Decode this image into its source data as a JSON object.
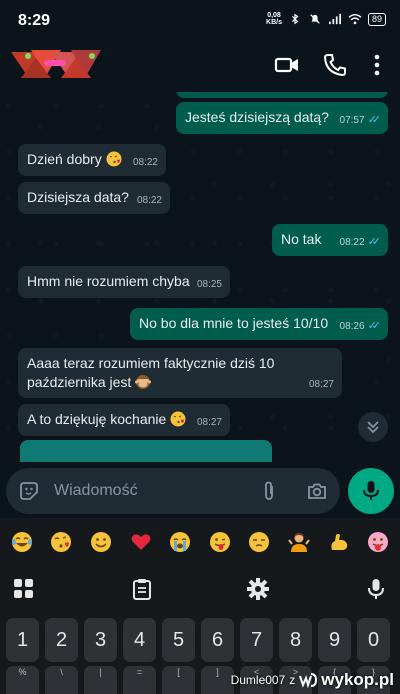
{
  "status_bar": {
    "time": "8:29",
    "speed_value": "0,08",
    "speed_unit": "KB/s",
    "battery": "89"
  },
  "header": {
    "icons": [
      "video-call-icon",
      "voice-call-icon",
      "more-vert-icon"
    ]
  },
  "messages": [
    {
      "dir": "out",
      "text": "Jesteś dzisiejszą datą?",
      "time": "07:57",
      "read": true
    },
    {
      "dir": "in",
      "text": "Dzień dobry",
      "emoji": "kissing-heart",
      "time": "08:22"
    },
    {
      "dir": "in",
      "text": "Dzisiejsza data?",
      "time": "08:22"
    },
    {
      "dir": "out",
      "text": "No tak",
      "time": "08:22",
      "read": true
    },
    {
      "dir": "in",
      "text": "Hmm nie rozumiem chyba",
      "time": "08:25"
    },
    {
      "dir": "out",
      "text": "No bo dla mnie to jesteś 10/10",
      "time": "08:26",
      "read": true
    },
    {
      "dir": "in",
      "text_line1": "Aaaa teraz rozumiem faktycznie dziś 10",
      "text_line2": "października jest",
      "emoji": "see-no-evil-monkey",
      "time": "08:27"
    },
    {
      "dir": "in",
      "text": "A to dziękuję kochanie",
      "emoji": "kissing-heart",
      "time": "08:27"
    }
  ],
  "input": {
    "placeholder": "Wiadomość"
  },
  "emoji_suggestions": [
    "tears-of-joy",
    "kissing-heart",
    "smile",
    "red-heart",
    "loudly-crying",
    "tongue-wink",
    "unamused",
    "shrug",
    "flexed-biceps",
    "tongue-face"
  ],
  "keyboard": {
    "toolbar_icons": [
      "apps-grid-icon",
      "clipboard-icon",
      "settings-gear-icon",
      "microphone-icon"
    ],
    "number_row": [
      "1",
      "2",
      "3",
      "4",
      "5",
      "6",
      "7",
      "8",
      "9",
      "0"
    ],
    "second_row_symbols": [
      "%",
      "\\",
      "|",
      "=",
      "[",
      "]",
      "<",
      ">",
      "{",
      "}"
    ]
  },
  "watermark": {
    "user": "Dumle007",
    "sep": "z",
    "brand": "wykop.pl"
  },
  "colors": {
    "bg": "#0b141a",
    "incoming_bubble": "#202c33",
    "outgoing_bubble": "#005c4b",
    "accent": "#00a884",
    "read_ticks": "#53bdeb"
  }
}
